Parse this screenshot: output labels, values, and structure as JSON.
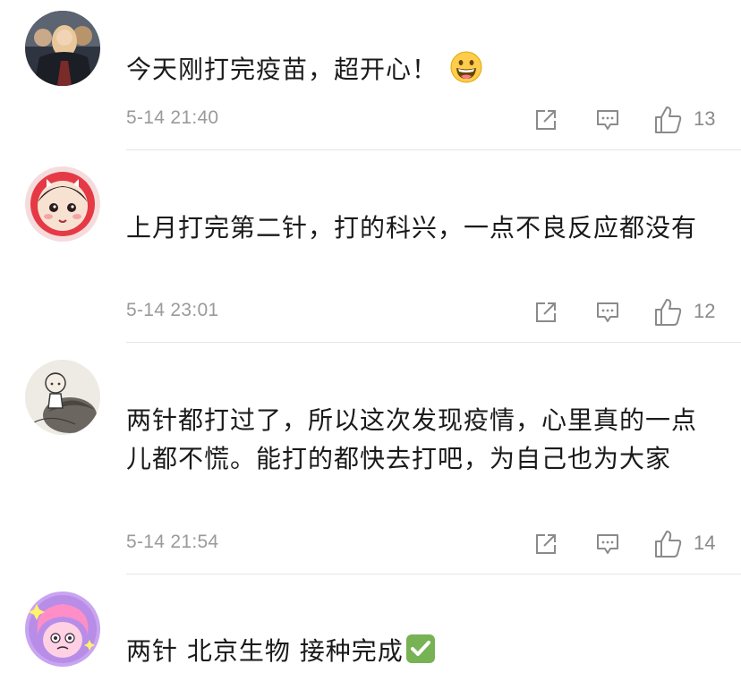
{
  "comments": [
    {
      "text": "今天刚打完疫苗，超开心！",
      "emoji": "grinning-face",
      "time": "5-14 21:40",
      "likes": "13"
    },
    {
      "text": "上月打完第二针，打的科兴，一点不良反应都没有",
      "time": "5-14 23:01",
      "likes": "12"
    },
    {
      "text": "两针都打过了，所以这次发现疫情，心里真的一点儿都不慌。能打的都快去打吧，为自己也为大家",
      "time": "5-14 21:54",
      "likes": "14"
    },
    {
      "text": "两针 北京生物 接种完成",
      "emoji": "check-mark-button",
      "time": "",
      "likes": ""
    }
  ],
  "colors": {
    "text": "#1a1a1a",
    "meta": "#9a9a9a",
    "divider": "#e5e5e5",
    "check": "#77b255"
  }
}
